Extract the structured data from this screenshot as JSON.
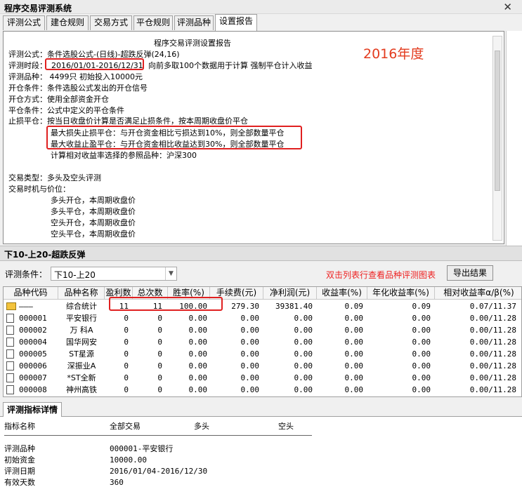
{
  "window": {
    "title": "程序交易评测系统",
    "close_glyph": "✕"
  },
  "tabs": [
    {
      "label": "评测公式"
    },
    {
      "label": "建仓规则"
    },
    {
      "label": "交易方式"
    },
    {
      "label": "平仓规则"
    },
    {
      "label": "评测品种"
    },
    {
      "label": "设置报告"
    }
  ],
  "report": {
    "heading": "程序交易评测设置报告",
    "formula": "评测公式：条件选股公式-(日线)-超跌反弹(24,16)",
    "period_label": "评测时段：",
    "period_value": "2016/01/01-2016/12/31",
    "period_note": "向前多取100个数据用于计算 强制平仓计入收益",
    "varieties": "评测品种：   4499只  初始投入10000元",
    "open_cond": "开仓条件：条件选股公式发出的开仓信号",
    "open_method": "开仓方式：使用全部资金开仓",
    "close_cond": "平仓条件：公式中定义的平仓条件",
    "stoploss": "止损平仓：按当日收盘价计算是否满足止损条件，按本周期收盘价平仓",
    "max_loss": "最大损失止损平仓：与开仓资金相比亏损达到10%，则全部数量平仓",
    "max_gain": "最大收益止盈平仓：与开仓资金相比收益达到30%，则全部数量平仓",
    "benchmark": "计算相对收益率选择的参照品种：沪深300",
    "trade_type": "交易类型：多头及空头评测",
    "trade_time": "交易时机与价位：",
    "rules": [
      "多头开仓，本周期收盘价",
      "多头平仓，本周期收盘价",
      "空头开仓，本周期收盘价",
      "空头平仓，本周期收盘价"
    ]
  },
  "annotation": "2016年度",
  "results": {
    "section_title": "下10-上20-超跌反弹",
    "condition_label": "评测条件：",
    "condition_value": "下10-上20",
    "hint": "双击列表行查看品种评测图表",
    "export_label": "导出结果",
    "columns": [
      "品种代码",
      "品种名称",
      "盈利数",
      "总次数",
      "胜率(%)",
      "手续费(元)",
      "净利润(元)",
      "收益率(%)",
      "年化收益率(%)",
      "相对收益率α/β(%)"
    ],
    "rows": [
      {
        "code": "———",
        "name": "综合统计",
        "win": "11",
        "total": "11",
        "rate": "100.00",
        "fee": "279.30",
        "profit": "39381.40",
        "ret": "0.09",
        "annual": "0.09",
        "rel": "0.07/11.37"
      },
      {
        "code": "000001",
        "name": "平安银行",
        "win": "0",
        "total": "0",
        "rate": "0.00",
        "fee": "0.00",
        "profit": "0.00",
        "ret": "0.00",
        "annual": "0.00",
        "rel": "0.00/11.28"
      },
      {
        "code": "000002",
        "name": "万 科A",
        "win": "0",
        "total": "0",
        "rate": "0.00",
        "fee": "0.00",
        "profit": "0.00",
        "ret": "0.00",
        "annual": "0.00",
        "rel": "0.00/11.28"
      },
      {
        "code": "000004",
        "name": "国华网安",
        "win": "0",
        "total": "0",
        "rate": "0.00",
        "fee": "0.00",
        "profit": "0.00",
        "ret": "0.00",
        "annual": "0.00",
        "rel": "0.00/11.28"
      },
      {
        "code": "000005",
        "name": "ST星源",
        "win": "0",
        "total": "0",
        "rate": "0.00",
        "fee": "0.00",
        "profit": "0.00",
        "ret": "0.00",
        "annual": "0.00",
        "rel": "0.00/11.28"
      },
      {
        "code": "000006",
        "name": "深振业A",
        "win": "0",
        "total": "0",
        "rate": "0.00",
        "fee": "0.00",
        "profit": "0.00",
        "ret": "0.00",
        "annual": "0.00",
        "rel": "0.00/11.28"
      },
      {
        "code": "000007",
        "name": "*ST全新",
        "win": "0",
        "total": "0",
        "rate": "0.00",
        "fee": "0.00",
        "profit": "0.00",
        "ret": "0.00",
        "annual": "0.00",
        "rel": "0.00/11.28"
      },
      {
        "code": "000008",
        "name": "神州高铁",
        "win": "0",
        "total": "0",
        "rate": "0.00",
        "fee": "0.00",
        "profit": "0.00",
        "ret": "0.00",
        "annual": "0.00",
        "rel": "0.00/11.28"
      }
    ]
  },
  "detail": {
    "tab_label": "评测指标详情",
    "headers": [
      "指标名称",
      "全部交易",
      "多头",
      "空头"
    ],
    "items": [
      {
        "label": "评测品种",
        "value": "000001-平安银行"
      },
      {
        "label": "初始资金",
        "value": "10000.00"
      },
      {
        "label": "评测日期",
        "value": "2016/01/04-2016/12/30"
      },
      {
        "label": "有效天数",
        "value": "360"
      }
    ]
  }
}
